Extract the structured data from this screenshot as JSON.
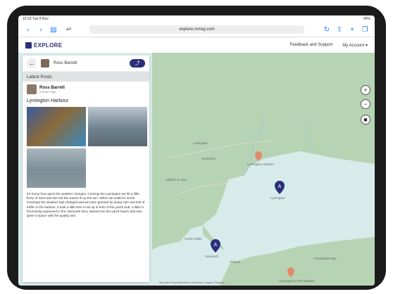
{
  "status": {
    "time": "10:33",
    "date": "Tue 8 Nov",
    "battery": "94%"
  },
  "browser": {
    "tab_text": "aA",
    "url": "explore.mmay.com"
  },
  "site": {
    "logo_text": "EXPLORE",
    "nav": {
      "feedback": "Feedback and Support",
      "account": "My Account ▾"
    }
  },
  "panel": {
    "username": "Ross Barrett",
    "latest_posts": "Latest Posts",
    "post": {
      "author": "Ross Barrett",
      "date": "2 hours ago",
      "title": "Lymington Harbour",
      "body": "It's funny how quick the weather changes. Coming into Lymington we hit a little flurry of wind and rain but the waves lit up the sun. When we sailed in at the moorings the weather had changed and we were greeted by heavy rain and lots of traffic in the harbour. It took a little time to tie up in front of the yacht club, a little in front being squeezed in the Yarmouth ferry. Moved into the yacht haven and was given a space with the quality and"
    }
  },
  "map": {
    "labels": {
      "lymington": "Lymington",
      "lymington_harbour": "Lymington Harbour",
      "lymington_marker": "Lymington",
      "yarmouth": "Yarmouth",
      "hurst": "Hurst Castle",
      "totland": "Totland",
      "freshwater": "Freshwater Bay",
      "keyhaven": "Keyhaven",
      "milford": "Milford on Sea",
      "the_needles": "Yarmouth to The Needles"
    },
    "attribution": "Map data ©OpenStreetMap contributors, Imagery ©Mapbox"
  },
  "colors": {
    "brand": "#2b2f7a",
    "pin_primary": "#2b2f7a",
    "pin_secondary": "#e28a6a",
    "water": "#d7ebea",
    "land": "#b6d3b4"
  }
}
